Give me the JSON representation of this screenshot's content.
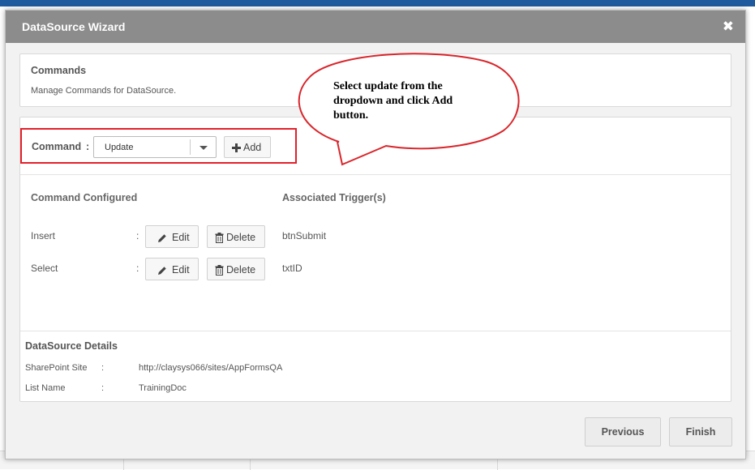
{
  "dialog": {
    "title": "DataSource Wizard",
    "close_glyph": "✖"
  },
  "commands_panel": {
    "title": "Commands",
    "subtitle": "Manage Commands for DataSource."
  },
  "command_select": {
    "label": "Command",
    "colon": ":",
    "value": "Update",
    "add_label": "Add",
    "add_icon": "plus-icon"
  },
  "configured": {
    "col_command": "Command Configured",
    "col_trigger": "Associated Trigger(s)",
    "edit_label": "Edit",
    "delete_label": "Delete",
    "rows": [
      {
        "name": "Insert",
        "colon": ":",
        "trigger": "btnSubmit"
      },
      {
        "name": "Select",
        "colon": ":",
        "trigger": "txtID"
      }
    ]
  },
  "details": {
    "title": "DataSource Details",
    "rows": [
      {
        "label": "SharePoint Site",
        "colon": ":",
        "value": "http://claysys066/sites/AppFormsQA"
      },
      {
        "label": "List Name",
        "colon": ":",
        "value": "TrainingDoc"
      }
    ]
  },
  "footer": {
    "previous_label": "Previous",
    "finish_label": "Finish"
  },
  "annotation": {
    "callout_text": "Select update from the dropdown and click Add button.",
    "highlight_color": "#e2202a",
    "callout_color": "#d9262c"
  },
  "colors": {
    "header_bg": "#8c8c8c",
    "dialog_bg": "#f2f2f2"
  }
}
